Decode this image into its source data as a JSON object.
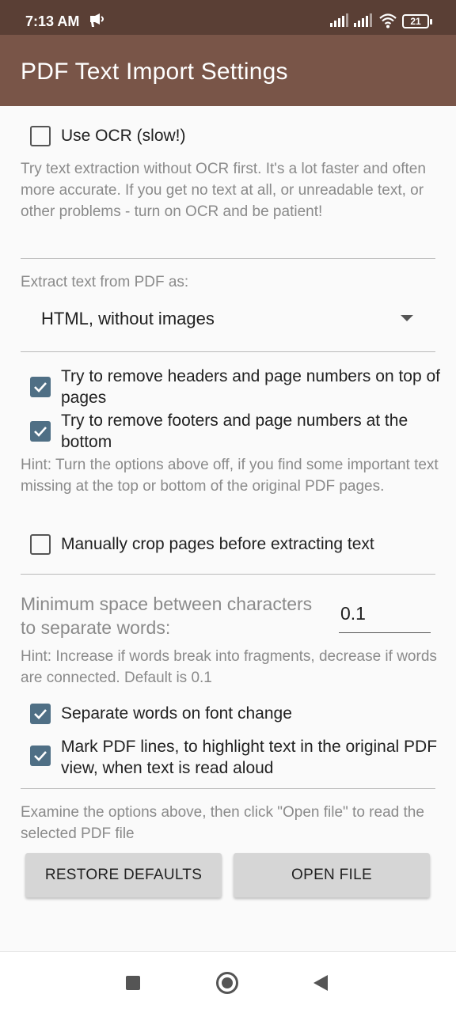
{
  "status_bar": {
    "time": "7:13 AM",
    "battery": "21"
  },
  "app_bar": {
    "title": "PDF Text Import Settings"
  },
  "options": {
    "use_ocr": {
      "label": "Use OCR (slow!)",
      "checked": false
    },
    "ocr_hint": "Try text extraction without OCR first. It's a lot faster and often more accurate. If you get no text at all, or unreadable text, or other problems - turn on OCR and be patient!",
    "extract_as_label": "Extract text from PDF as:",
    "extract_as_value": "HTML, without images",
    "remove_headers": {
      "label": "Try to remove headers and page numbers on top of pages",
      "checked": true
    },
    "remove_footers": {
      "label": "Try to remove footers and page numbers at the bottom",
      "checked": true
    },
    "headers_hint": "Hint: Turn the options above off, if you find some important text missing at the top or bottom of the original PDF pages.",
    "manual_crop": {
      "label": "Manually crop pages before extracting text",
      "checked": false
    },
    "min_space_label": "Minimum space between characters to separate words:",
    "min_space_value": "0.1",
    "min_space_hint": "Hint: Increase if words break into fragments, decrease if words are connected. Default is 0.1",
    "separate_font_change": {
      "label": "Separate words on font change",
      "checked": true
    },
    "mark_pdf_lines": {
      "label": "Mark PDF lines, to highlight text in the original PDF view, when text is read aloud",
      "checked": true
    },
    "footer_hint": "Examine the options above, then click \"Open file\" to read the selected PDF file"
  },
  "buttons": {
    "restore": "RESTORE DEFAULTS",
    "open": "OPEN FILE"
  },
  "colors": {
    "status_bar": "#5a3f35",
    "app_bar": "#795548",
    "checkbox_checked": "#4f6f85"
  }
}
